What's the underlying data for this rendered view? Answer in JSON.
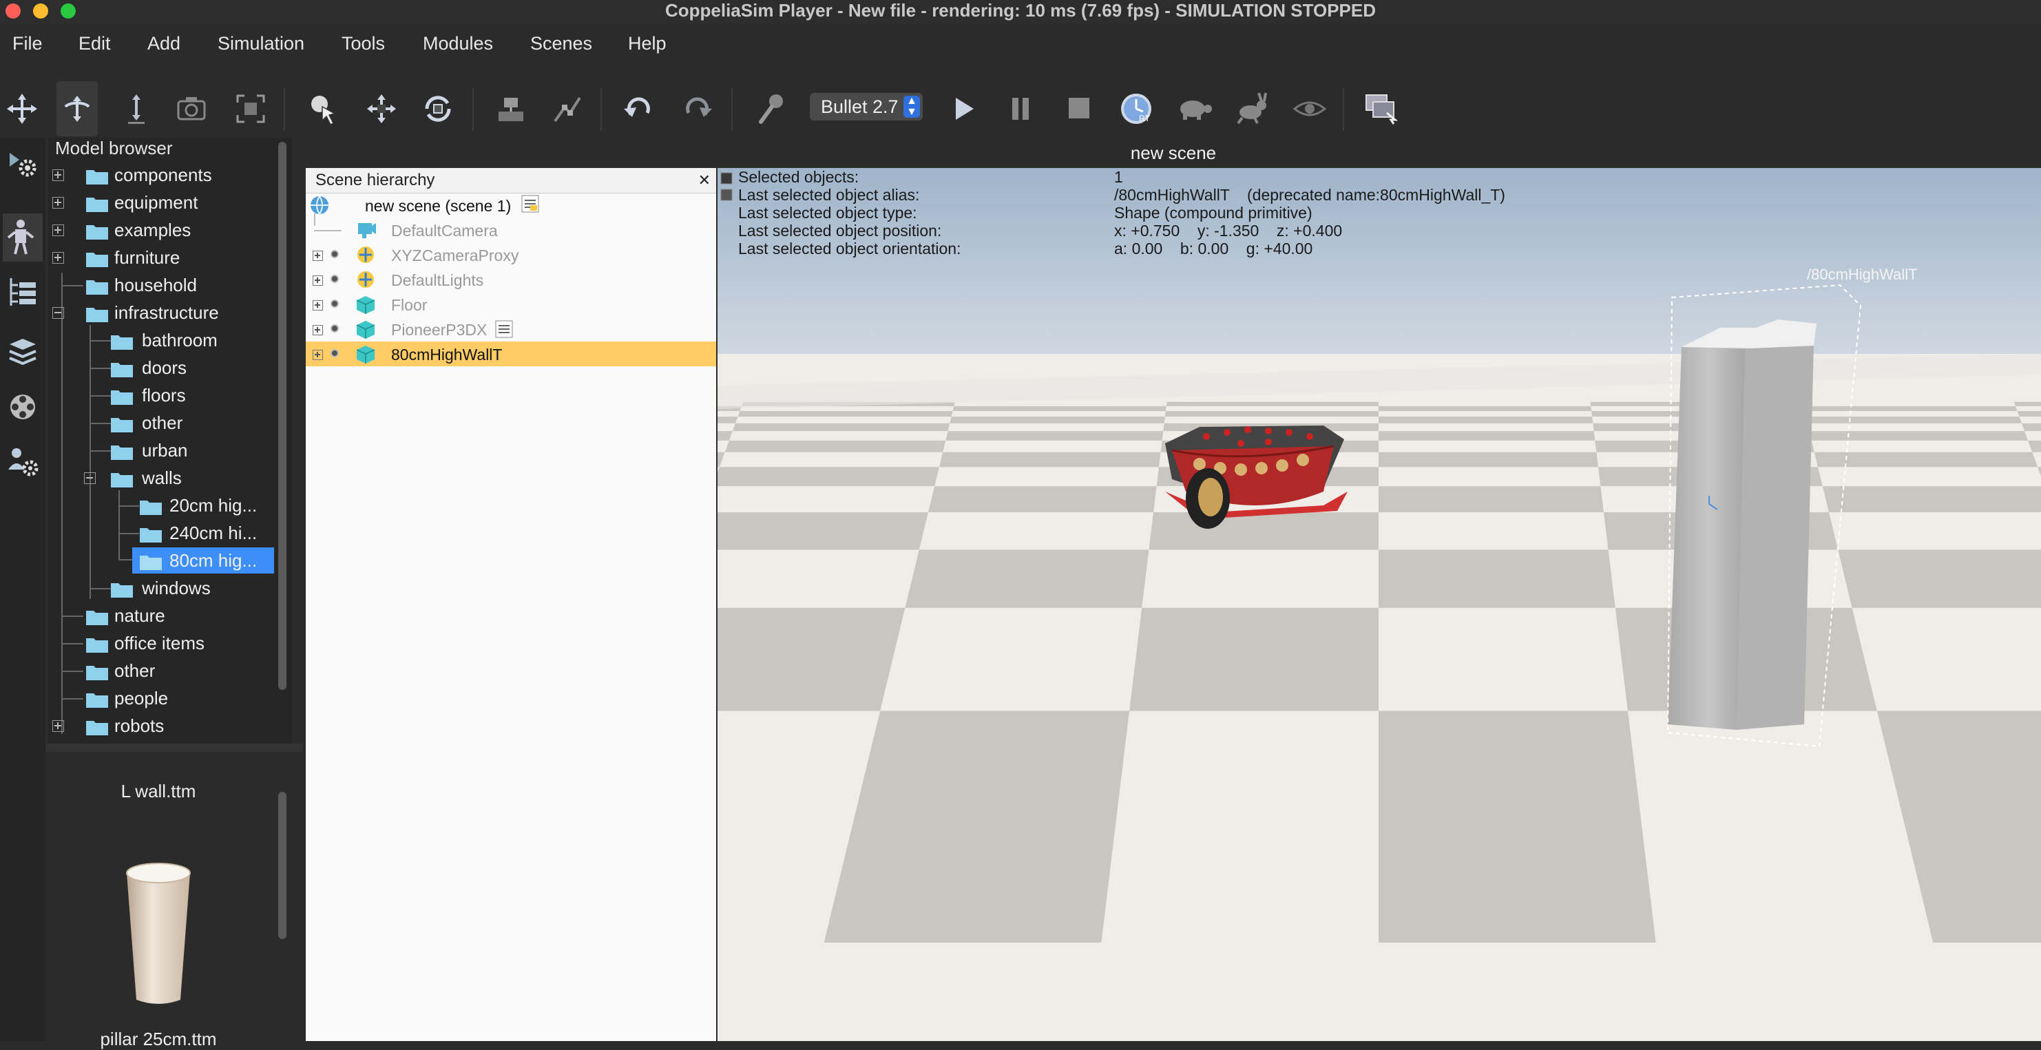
{
  "window": {
    "title": "CoppeliaSim Player - New file - rendering: 10 ms (7.69 fps) - SIMULATION STOPPED"
  },
  "menu": [
    "File",
    "Edit",
    "Add",
    "Simulation",
    "Tools",
    "Modules",
    "Scenes",
    "Help"
  ],
  "toolbar": {
    "engine": "Bullet 2.7",
    "icons": [
      "move-view-icon",
      "rotate-view-icon",
      "shift-view-icon",
      "camera-icon",
      "fit-view-icon",
      "select-icon",
      "translate-object-icon",
      "rotate-object-icon",
      "assemble-icon",
      "path-edit-icon",
      "undo-icon",
      "redo-icon",
      "dynamics-icon",
      "play-icon",
      "pause-icon",
      "stop-icon",
      "realtime-icon",
      "slow-down-icon",
      "speed-up-icon",
      "visualization-icon",
      "page-selector-icon"
    ]
  },
  "model_browser": {
    "title": "Model browser",
    "items": [
      {
        "label": "components"
      },
      {
        "label": "equipment"
      },
      {
        "label": "examples"
      },
      {
        "label": "furniture"
      },
      {
        "label": "household"
      },
      {
        "label": "infrastructure"
      },
      {
        "label": "bathroom"
      },
      {
        "label": "doors"
      },
      {
        "label": "floors"
      },
      {
        "label": "other"
      },
      {
        "label": "urban"
      },
      {
        "label": "walls"
      },
      {
        "label": "20cm hig..."
      },
      {
        "label": "240cm hi..."
      },
      {
        "label": "80cm hig..."
      },
      {
        "label": "windows"
      },
      {
        "label": "nature"
      },
      {
        "label": "office items"
      },
      {
        "label": "other"
      },
      {
        "label": "people"
      },
      {
        "label": "robots"
      }
    ]
  },
  "preview": {
    "item1": "L wall.ttm",
    "item2": "pillar 25cm.ttm"
  },
  "scene": {
    "title": "new scene"
  },
  "hierarchy": {
    "title": "Scene hierarchy",
    "close": "✕",
    "root": "new scene (scene 1)",
    "items": [
      {
        "label": "DefaultCamera"
      },
      {
        "label": "XYZCameraProxy"
      },
      {
        "label": "DefaultLights"
      },
      {
        "label": "Floor"
      },
      {
        "label": "PioneerP3DX"
      },
      {
        "label": "80cmHighWallT"
      }
    ]
  },
  "info": {
    "labels": [
      "Selected objects:",
      "Last selected object alias:",
      "Last selected object type:",
      "Last selected object position:",
      "Last selected object orientation:"
    ],
    "values": [
      "1",
      "/80cmHighWallT    (deprecated name:80cmHighWall_T)",
      "Shape (compound primitive)",
      "x: +0.750    y: -1.350    z: +0.400",
      "a: 0.00    b: 0.00    g: +40.00"
    ]
  },
  "viewport": {
    "object_label": "/80cmHighWallT"
  },
  "colors": {
    "selection": "#ffcc66",
    "tree_selection": "#3d8ef7",
    "sky_top": "#9fb4ca",
    "sky_bottom": "#d6dde4"
  }
}
